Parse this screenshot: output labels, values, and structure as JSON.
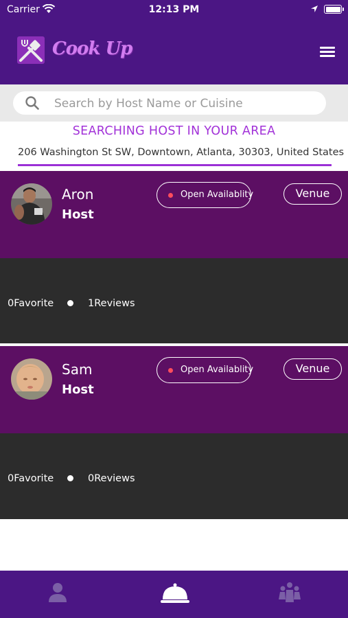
{
  "status_bar": {
    "carrier": "Carrier",
    "time": "12:13 PM"
  },
  "app": {
    "logo_text": "Cook Up"
  },
  "search": {
    "placeholder": "Search by Host Name or Cuisine"
  },
  "area": {
    "title": "SEARCHING HOST IN YOUR AREA",
    "address": "206 Washington St SW, Downtown, Atlanta, 30303, United States"
  },
  "hosts": [
    {
      "name": "Aron",
      "role": "Host",
      "availability_label": "Open Availablity",
      "venue_label": "Venue",
      "favorites": "0Favorite",
      "reviews": "1Reviews"
    },
    {
      "name": "Sam",
      "role": "Host",
      "availability_label": "Open Availablity",
      "venue_label": "Venue",
      "favorites": "0Favorite",
      "reviews": "0Reviews"
    }
  ],
  "tabs": [
    {
      "icon": "profile-icon"
    },
    {
      "icon": "cloche-icon",
      "active": true
    },
    {
      "icon": "community-icon"
    }
  ],
  "colors": {
    "header": "#4b1684",
    "card_top": "#5c0f63",
    "card_bottom": "#2c2c2c",
    "accent": "#a232d8",
    "availability_dot": "#ff4d5d"
  }
}
